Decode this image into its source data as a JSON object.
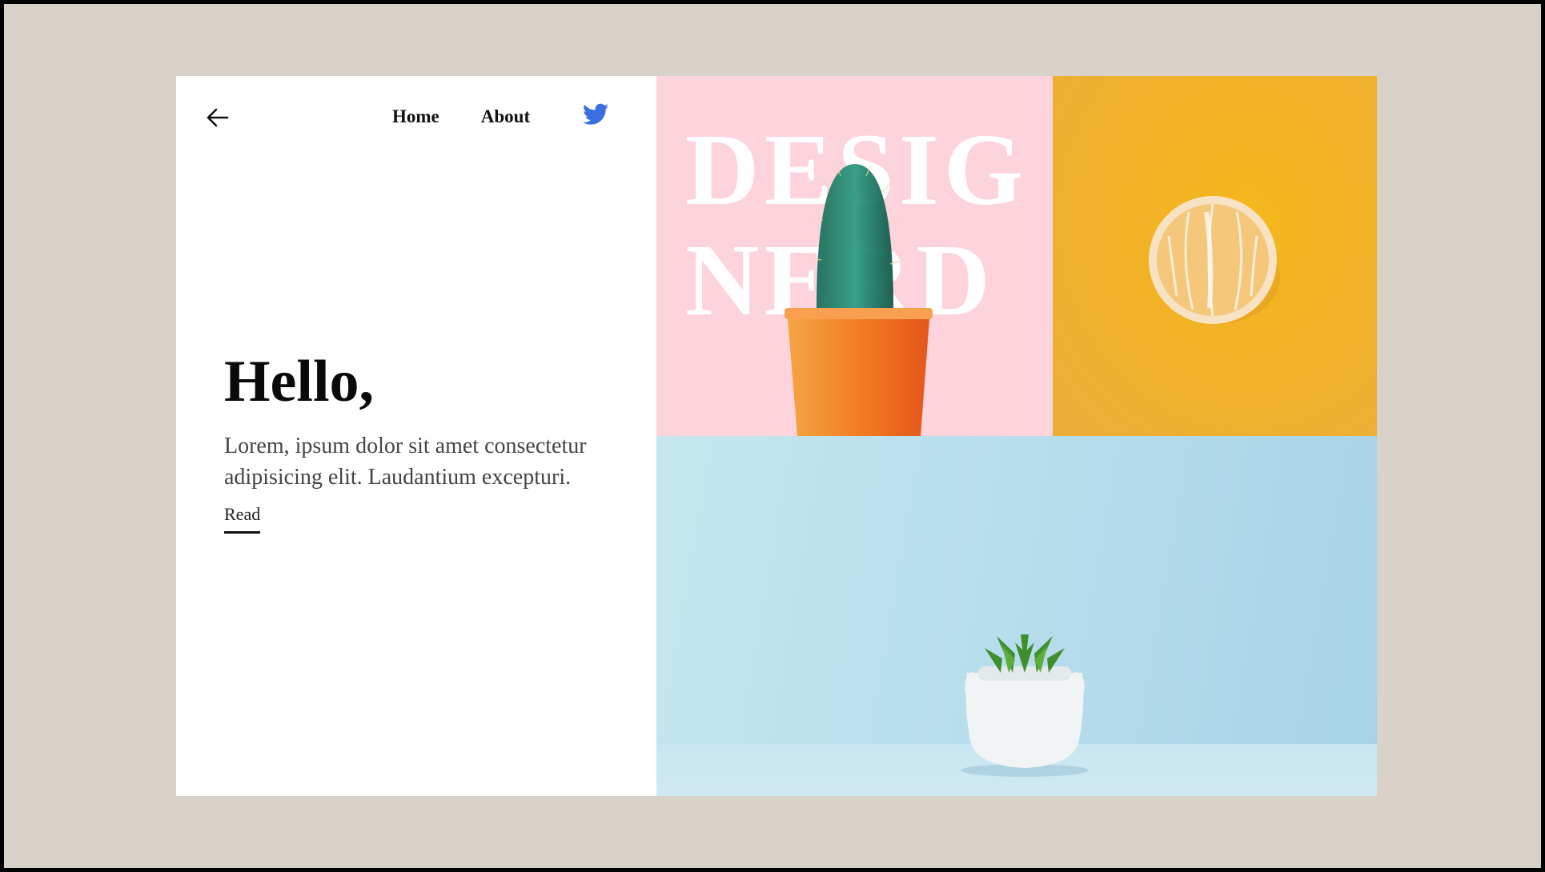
{
  "nav": {
    "back_icon": "arrow-left-icon",
    "items": [
      {
        "label": "Home"
      },
      {
        "label": "About"
      }
    ],
    "social_icon": "twitter-icon",
    "social_color": "#3b6fe0"
  },
  "hero": {
    "title": "Hello,",
    "description": "Lorem, ipsum dolor sit amet consectetur adipisicing elit. Laudantium excepturi.",
    "read_label": "Read"
  },
  "gallery": {
    "headline_line1": "DESIG",
    "headline_line2": "NERD",
    "tiles": [
      {
        "name": "cactus-photo",
        "background": "#fdd3dc"
      },
      {
        "name": "orange-photo",
        "background": "#f0b02a"
      },
      {
        "name": "succulent-photo",
        "background": "#b6dcec"
      }
    ]
  },
  "colors": {
    "page_background": "#d9d2c8",
    "card_background": "#ffffff",
    "text_dark": "#0a0a0a"
  }
}
